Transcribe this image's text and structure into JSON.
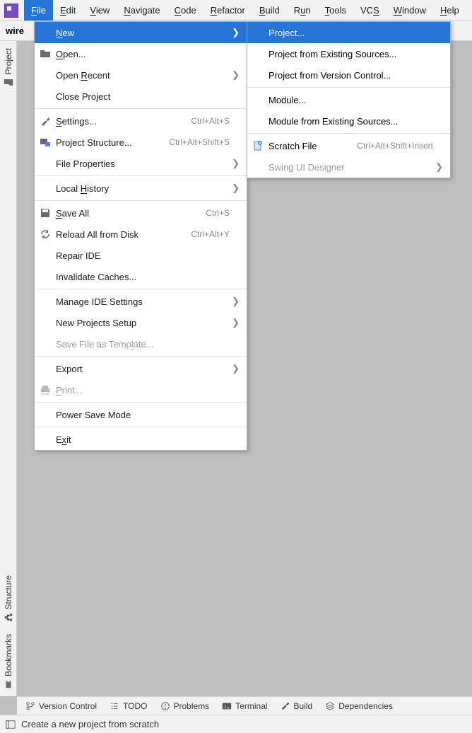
{
  "menubar": {
    "items": [
      {
        "pre": "",
        "u": "F",
        "post": "ile"
      },
      {
        "pre": "",
        "u": "E",
        "post": "dit"
      },
      {
        "pre": "",
        "u": "V",
        "post": "iew"
      },
      {
        "pre": "",
        "u": "N",
        "post": "avigate"
      },
      {
        "pre": "",
        "u": "C",
        "post": "ode"
      },
      {
        "pre": "",
        "u": "R",
        "post": "efactor"
      },
      {
        "pre": "",
        "u": "B",
        "post": "uild"
      },
      {
        "pre": "R",
        "u": "u",
        "post": "n"
      },
      {
        "pre": "",
        "u": "T",
        "post": "ools"
      },
      {
        "pre": "VC",
        "u": "S",
        "post": ""
      },
      {
        "pre": "",
        "u": "W",
        "post": "indow"
      },
      {
        "pre": "",
        "u": "H",
        "post": "elp"
      }
    ]
  },
  "crumb": "wire",
  "left_gutter": {
    "top": [
      {
        "label": "Project"
      }
    ],
    "bottom": [
      {
        "label": "Structure"
      },
      {
        "label": "Bookmarks"
      }
    ]
  },
  "file_menu": [
    {
      "type": "item",
      "u": "N",
      "post": "ew",
      "pre": "",
      "arrow": true,
      "selected": true
    },
    {
      "type": "item",
      "u": "O",
      "post": "pen...",
      "pre": "",
      "icon": "folder"
    },
    {
      "type": "item",
      "pre": "Open ",
      "u": "R",
      "post": "ecent",
      "arrow": true
    },
    {
      "type": "item",
      "pre": "Close Project",
      "u": "",
      "post": ""
    },
    {
      "type": "sep"
    },
    {
      "type": "item",
      "u": "S",
      "post": "ettings...",
      "pre": "",
      "icon": "wrench",
      "shortcut": "Ctrl+Alt+S"
    },
    {
      "type": "item",
      "pre": "Project Structure...",
      "u": "",
      "post": "",
      "icon": "proj",
      "shortcut": "Ctrl+Alt+Shift+S"
    },
    {
      "type": "item",
      "pre": "File Properties",
      "u": "",
      "post": "",
      "arrow": true
    },
    {
      "type": "sep"
    },
    {
      "type": "item",
      "pre": "Local ",
      "u": "H",
      "post": "istory",
      "arrow": true
    },
    {
      "type": "sep"
    },
    {
      "type": "item",
      "u": "S",
      "post": "ave All",
      "pre": "",
      "icon": "save",
      "shortcut": "Ctrl+S"
    },
    {
      "type": "item",
      "pre": "Reload All from Disk",
      "u": "",
      "post": "",
      "icon": "reload",
      "shortcut": "Ctrl+Alt+Y"
    },
    {
      "type": "item",
      "pre": "Repair IDE",
      "u": "",
      "post": ""
    },
    {
      "type": "item",
      "pre": "Invalidate Caches...",
      "u": "",
      "post": ""
    },
    {
      "type": "sep"
    },
    {
      "type": "item",
      "pre": "Manage IDE Settings",
      "u": "",
      "post": "",
      "arrow": true
    },
    {
      "type": "item",
      "pre": "New Projects Setup",
      "u": "",
      "post": "",
      "arrow": true
    },
    {
      "type": "item",
      "pre": "Save File as Temp",
      "u": "l",
      "post": "ate...",
      "disabled": true
    },
    {
      "type": "sep"
    },
    {
      "type": "item",
      "pre": "Export",
      "u": "",
      "post": "",
      "arrow": true
    },
    {
      "type": "item",
      "u": "P",
      "post": "rint...",
      "pre": "",
      "icon": "print",
      "disabled": true
    },
    {
      "type": "sep"
    },
    {
      "type": "item",
      "pre": "Power Save Mode",
      "u": "",
      "post": ""
    },
    {
      "type": "sep"
    },
    {
      "type": "item",
      "pre": "E",
      "u": "x",
      "post": "it"
    }
  ],
  "new_submenu": [
    {
      "type": "item",
      "pre": "Project...",
      "selected": true
    },
    {
      "type": "item",
      "pre": "Project from Existing Sources..."
    },
    {
      "type": "item",
      "pre": "Project from Version Control..."
    },
    {
      "type": "sep"
    },
    {
      "type": "item",
      "pre": "Module..."
    },
    {
      "type": "item",
      "pre": "Module from Existing Sources..."
    },
    {
      "type": "sep"
    },
    {
      "type": "item",
      "pre": "Scratch File",
      "icon": "scratch",
      "shortcut": "Ctrl+Alt+Shift+Insert"
    },
    {
      "type": "item",
      "pre": "Swing UI Designer",
      "arrow": true,
      "disabled": true
    }
  ],
  "toolwindows": [
    {
      "label": "Version Control",
      "icon": "branch"
    },
    {
      "label": "TODO",
      "icon": "list"
    },
    {
      "label": "Problems",
      "icon": "warn"
    },
    {
      "label": "Terminal",
      "icon": "term"
    },
    {
      "label": "Build",
      "icon": "hammer"
    },
    {
      "label": "Dependencies",
      "icon": "layers"
    }
  ],
  "status": "Create a new project from scratch"
}
